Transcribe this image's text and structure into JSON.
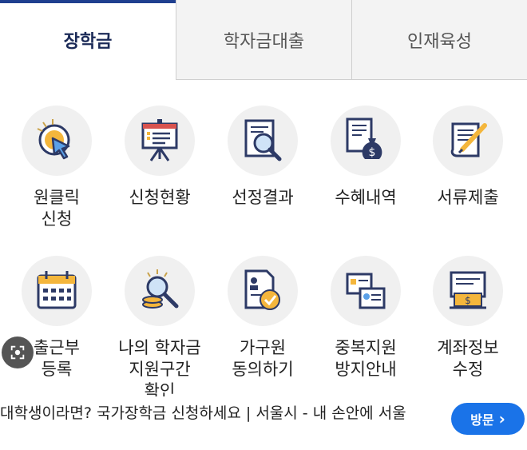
{
  "tabs": [
    {
      "label": "장학금",
      "active": true
    },
    {
      "label": "학자금대출",
      "active": false
    },
    {
      "label": "인재육성",
      "active": false
    }
  ],
  "menu_row1": [
    {
      "label": "원클릭\n신청",
      "icon": "click-icon"
    },
    {
      "label": "신청현황",
      "icon": "presentation-board-icon"
    },
    {
      "label": "선정결과",
      "icon": "document-search-icon"
    },
    {
      "label": "수혜내역",
      "icon": "money-bag-document-icon"
    },
    {
      "label": "서류제출",
      "icon": "scroll-pen-icon"
    }
  ],
  "menu_row2": [
    {
      "label": "출근부\n등록",
      "icon": "calendar-icon"
    },
    {
      "label": "나의 학자금\n지원구간\n확인",
      "icon": "coins-magnifier-icon"
    },
    {
      "label": "가구원\n동의하기",
      "icon": "document-check-icon"
    },
    {
      "label": "중복지원\n방지안내",
      "icon": "duplicate-cards-icon"
    },
    {
      "label": "계좌정보\n수정",
      "icon": "bank-account-icon"
    }
  ],
  "ad": {
    "text": "대학생이라면? 국가장학금 신청하세요 | 서울시 - 내 손안에 서울",
    "button_label": "방문",
    "button_arrow": "›"
  },
  "colors": {
    "active_tab_text": "#1b2a57",
    "active_tab_bar": "#1f3f8f",
    "icon_bg": "#f0f0f0",
    "button": "#1a73e8"
  }
}
